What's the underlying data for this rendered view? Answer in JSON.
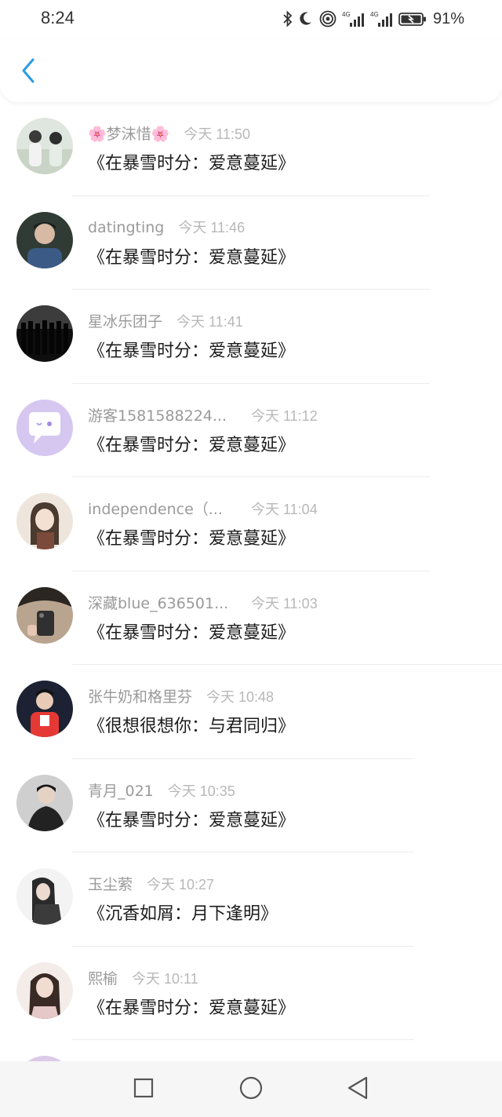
{
  "status_bar": {
    "time": "8:24",
    "network_1": "4G",
    "network_2": "4G",
    "battery_percent": "91%"
  },
  "header": {
    "back_icon": "chevron-left-icon",
    "accent_color": "#2b9ae8"
  },
  "items": [
    {
      "name": "🌸梦沫惜🌸",
      "time": "今天 11:50",
      "title": "《在暴雪时分：爱意蔓延》"
    },
    {
      "name": "datingting",
      "time": "今天 11:46",
      "title": "《在暴雪时分：爱意蔓延》"
    },
    {
      "name": "星冰乐团子",
      "time": "今天 11:41",
      "title": "《在暴雪时分：爱意蔓延》"
    },
    {
      "name": "游客1581588224...",
      "time": "今天 11:12",
      "title": "《在暴雪时分：爱意蔓延》"
    },
    {
      "name": "independence（...",
      "time": "今天 11:04",
      "title": "《在暴雪时分：爱意蔓延》"
    },
    {
      "name": "深藏blue_636501...",
      "time": "今天 11:03",
      "title": "《在暴雪时分：爱意蔓延》"
    },
    {
      "name": "张牛奶和格里芬",
      "time": "今天 10:48",
      "title": "《很想很想你：与君同归》"
    },
    {
      "name": "青月_021",
      "time": "今天 10:35",
      "title": "《在暴雪时分：爱意蔓延》"
    },
    {
      "name": "玉尘萦",
      "time": "今天 10:27",
      "title": "《沉香如屑：月下逢明》"
    },
    {
      "name": "熙榆",
      "time": "今天 10:11",
      "title": "《在暴雪时分：爱意蔓延》"
    }
  ],
  "system_nav": {
    "recents": "square-icon",
    "home": "circle-icon",
    "back": "triangle-back-icon"
  }
}
